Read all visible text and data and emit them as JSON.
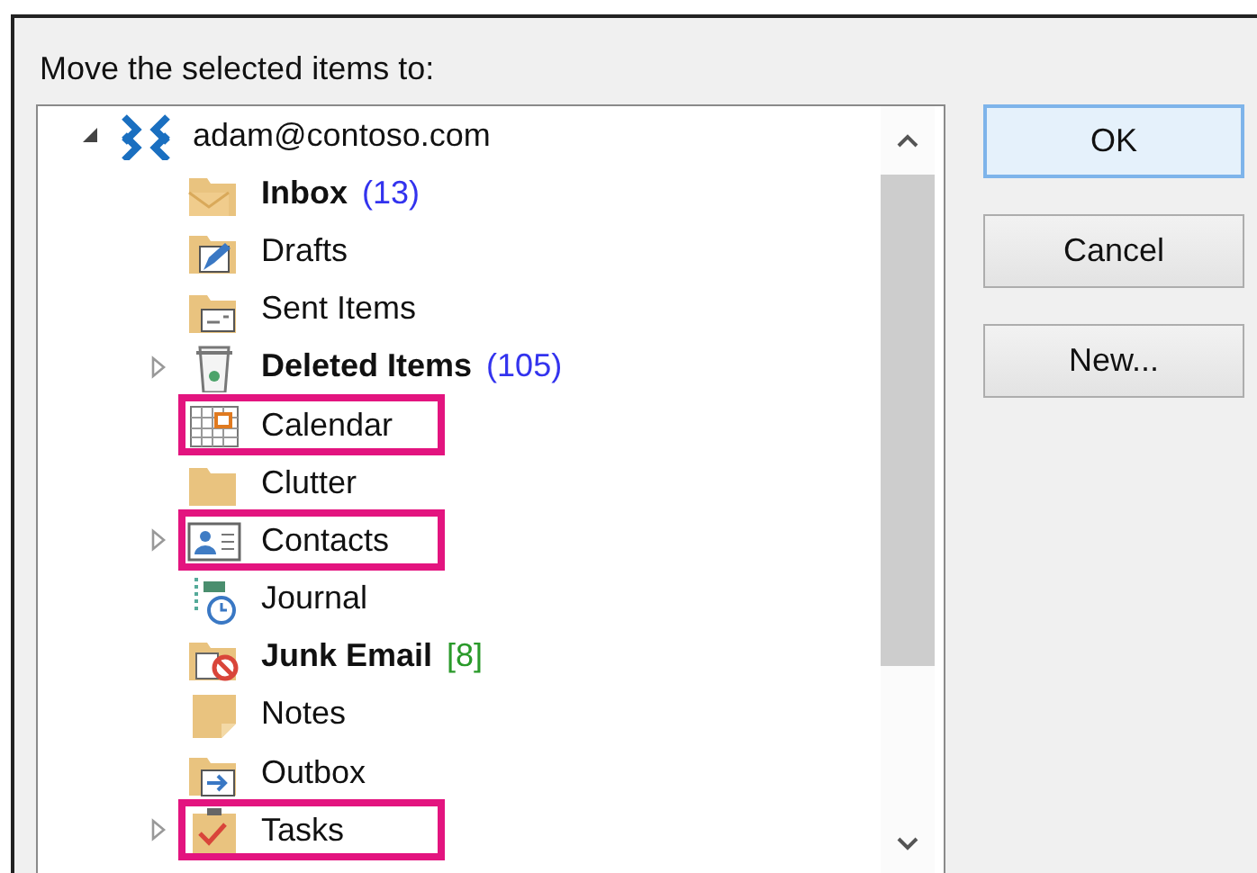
{
  "dialog": {
    "prompt": "Move the selected items to:"
  },
  "tree": {
    "account": {
      "name": "adam@contoso.com",
      "expanded": true,
      "children": [
        {
          "name": "Inbox",
          "kind": "inbox",
          "bold": true,
          "count": {
            "text": "(13)",
            "color": "#3333ee"
          },
          "expandable": false,
          "highlighted": false
        },
        {
          "name": "Drafts",
          "kind": "drafts",
          "bold": false,
          "expandable": false,
          "highlighted": false
        },
        {
          "name": "Sent Items",
          "kind": "sent",
          "bold": false,
          "expandable": false,
          "highlighted": false
        },
        {
          "name": "Deleted Items",
          "kind": "deleted",
          "bold": true,
          "count": {
            "text": "(105)",
            "color": "#3333ee"
          },
          "expandable": true,
          "highlighted": false
        },
        {
          "name": "Calendar",
          "kind": "calendar",
          "bold": false,
          "expandable": false,
          "highlighted": true
        },
        {
          "name": "Clutter",
          "kind": "folder",
          "bold": false,
          "expandable": false,
          "highlighted": false
        },
        {
          "name": "Contacts",
          "kind": "contacts",
          "bold": false,
          "expandable": true,
          "highlighted": true
        },
        {
          "name": "Journal",
          "kind": "journal",
          "bold": false,
          "expandable": false,
          "highlighted": false
        },
        {
          "name": "Junk Email",
          "kind": "junk",
          "bold": true,
          "count": {
            "text": "[8]",
            "color": "#2a9a2a"
          },
          "expandable": false,
          "highlighted": false
        },
        {
          "name": "Notes",
          "kind": "notes",
          "bold": false,
          "expandable": false,
          "highlighted": false
        },
        {
          "name": "Outbox",
          "kind": "outbox",
          "bold": false,
          "expandable": false,
          "highlighted": false
        },
        {
          "name": "Tasks",
          "kind": "tasks",
          "bold": false,
          "expandable": true,
          "highlighted": true
        }
      ]
    }
  },
  "buttons": [
    {
      "label": "OK",
      "default": true
    },
    {
      "label": "Cancel",
      "default": false
    },
    {
      "label": "New...",
      "default": false
    }
  ]
}
